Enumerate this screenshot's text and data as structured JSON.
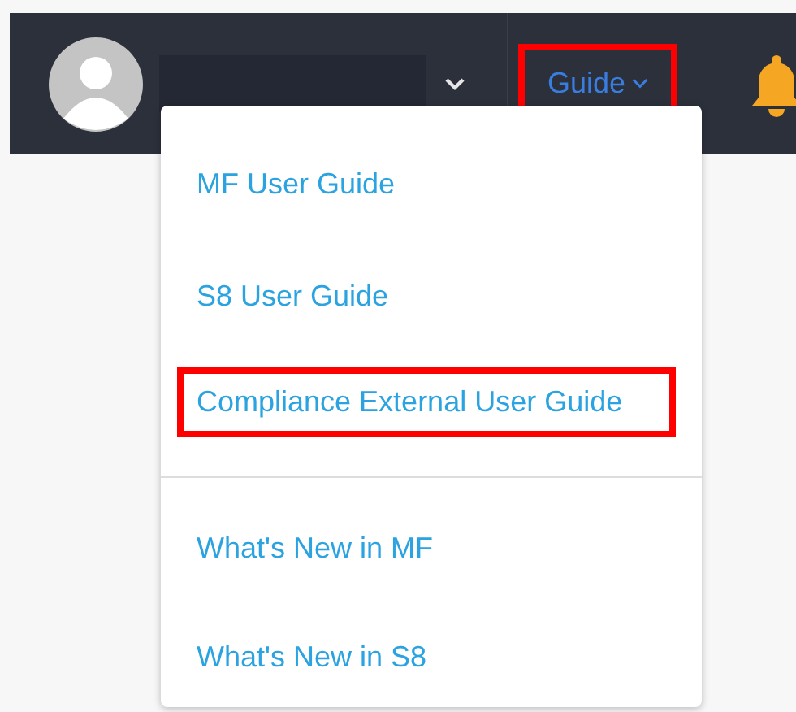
{
  "navbar": {
    "guide_menu": {
      "label": "Guide",
      "highlighted": true
    }
  },
  "dropdown": {
    "groups": [
      [
        {
          "label": "MF User Guide",
          "highlighted": false
        },
        {
          "label": "S8 User Guide",
          "highlighted": false
        },
        {
          "label": "Compliance External User Guide",
          "highlighted": true
        }
      ],
      [
        {
          "label": "What's New in MF",
          "highlighted": false
        },
        {
          "label": "What's New in S8",
          "highlighted": false
        }
      ]
    ]
  }
}
